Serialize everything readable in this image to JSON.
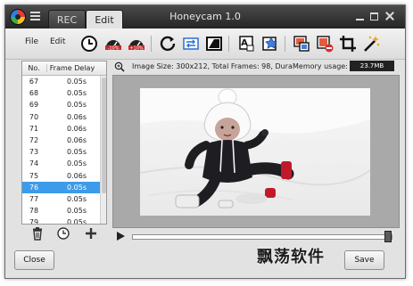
{
  "window": {
    "title": "Honeycam 1.0"
  },
  "tabs": [
    {
      "label": "REC"
    },
    {
      "label": "Edit"
    }
  ],
  "menu": {
    "file": "File",
    "edit": "Edit"
  },
  "frame_list": {
    "headers": {
      "no": "No.",
      "delay": "Frame Delay"
    },
    "rows": [
      {
        "no": "67",
        "delay": "0.05s"
      },
      {
        "no": "68",
        "delay": "0.05s"
      },
      {
        "no": "69",
        "delay": "0.05s"
      },
      {
        "no": "70",
        "delay": "0.06s"
      },
      {
        "no": "71",
        "delay": "0.06s"
      },
      {
        "no": "72",
        "delay": "0.06s"
      },
      {
        "no": "73",
        "delay": "0.05s"
      },
      {
        "no": "74",
        "delay": "0.05s"
      },
      {
        "no": "75",
        "delay": "0.06s"
      },
      {
        "no": "76",
        "delay": "0.05s"
      },
      {
        "no": "77",
        "delay": "0.05s"
      },
      {
        "no": "78",
        "delay": "0.05s"
      },
      {
        "no": "79",
        "delay": "0.05s"
      }
    ],
    "selected_no": "76"
  },
  "info": {
    "image_size": "Image Size: 300x212, Total Frames: 98, Durat",
    "memory_label": "Memory usage:",
    "memory_value": "23.7MB"
  },
  "buttons": {
    "close": "Close",
    "save": "Save"
  },
  "watermark": "飘荡软件",
  "colors": {
    "selection": "#3d9be9",
    "titlebar": "#2e2e2e"
  }
}
